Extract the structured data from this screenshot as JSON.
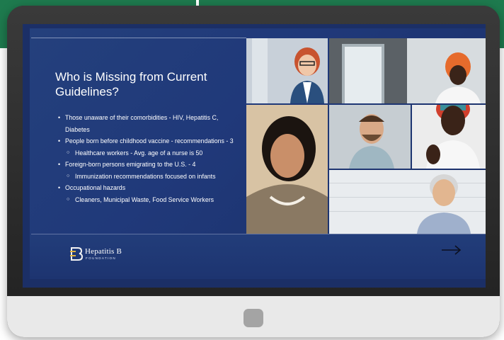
{
  "slide": {
    "title": "Who is Missing from Current Guidelines?",
    "bullets": [
      {
        "level": 1,
        "text": "Those unaware of their comorbidities - HIV, Hepatitis C, Diabetes"
      },
      {
        "level": 1,
        "text": "People born before childhood vaccine - recommendations - 3"
      },
      {
        "level": 2,
        "text": "Healthcare workers - Avg. age of a nurse is 50"
      },
      {
        "level": 1,
        "text": "Foreign-born persons emigrating to the U.S. - 4"
      },
      {
        "level": 2,
        "text": "Immunization recommendations focused on infants"
      },
      {
        "level": 1,
        "text": "Occupational hazards"
      },
      {
        "level": 2,
        "text": "Cleaners, Municipal Waste, Food Service Workers"
      }
    ],
    "logo": {
      "name": "Hepatitis B",
      "sub": "FOUNDATION"
    },
    "next_arrow_icon": "arrow-right-icon"
  },
  "colors": {
    "slide_bg": "#20397a",
    "header_green": "#1e7a4e",
    "monitor_bezel": "#2b2b2b",
    "monitor_chin": "#e9e9e9"
  }
}
